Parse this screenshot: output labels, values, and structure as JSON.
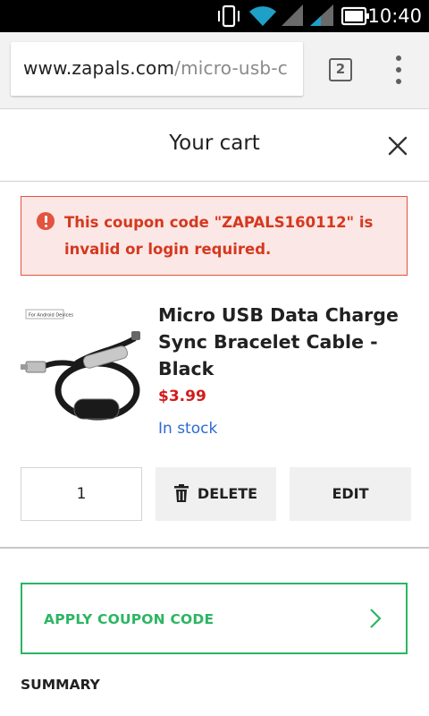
{
  "status_bar": {
    "time": "10:40"
  },
  "browser": {
    "url_host": "www.zapals.com",
    "url_path": "/micro-usb-c",
    "tab_count": "2"
  },
  "cart": {
    "title": "Your cart"
  },
  "alert": {
    "message": "This coupon code \"ZAPALS160112\" is invalid or login required."
  },
  "product": {
    "name": "Micro USB Data Charge Sync Bracelet Cable - Black",
    "price": "$3.99",
    "stock": "In stock",
    "image_label": "For Android Devices"
  },
  "actions": {
    "quantity": "1",
    "delete_label": "DELETE",
    "edit_label": "EDIT"
  },
  "coupon": {
    "label": "APPLY COUPON CODE"
  },
  "summary": {
    "heading": "SUMMARY"
  },
  "colors": {
    "error": "#d5381f",
    "price": "#d31c1c",
    "stock": "#2d6ad2",
    "coupon": "#2cb563"
  }
}
